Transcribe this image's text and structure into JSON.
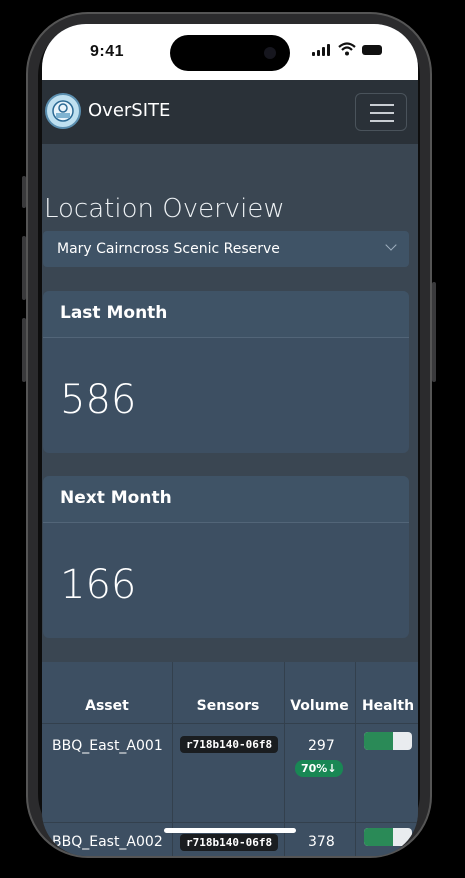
{
  "status_bar": {
    "time": "9:41"
  },
  "navbar": {
    "brand": "OverSITE"
  },
  "page": {
    "title": "Location Overview",
    "location_select": {
      "selected": "Mary Cairncross Scenic Reserve"
    }
  },
  "cards": [
    {
      "title": "Last Month",
      "value": "586"
    },
    {
      "title": "Next Month",
      "value": "166"
    }
  ],
  "table": {
    "headers": [
      "Asset",
      "Sensors",
      "Volume",
      "Health"
    ],
    "rows": [
      {
        "asset": "BBQ_East_A001",
        "sensor": "r718b140-06f8",
        "volume": "297",
        "change": "70%↓",
        "health": 0.6
      },
      {
        "asset": "BBQ_East_A002",
        "sensor": "r718b140-06f8",
        "volume": "378",
        "health": 0.6
      }
    ]
  },
  "colors": {
    "accent": "#198754",
    "navbar": "#2a3138",
    "card": "#3d4f62"
  }
}
